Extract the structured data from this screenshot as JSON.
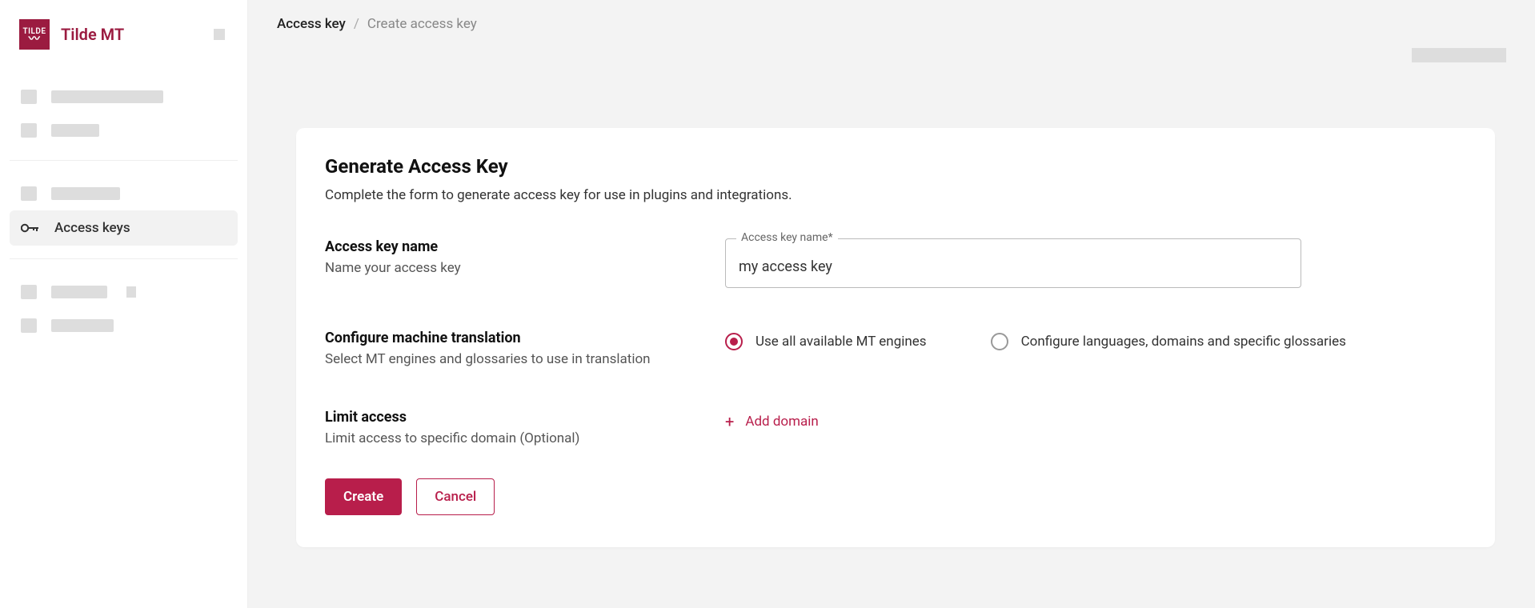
{
  "brand": {
    "logo_text": "TILDE",
    "name": "Tilde MT"
  },
  "sidebar": {
    "active_item_label": "Access keys"
  },
  "breadcrumb": {
    "parent": "Access key",
    "separator": "/",
    "current": "Create access key"
  },
  "page": {
    "title": "Generate Access Key",
    "subtitle": "Complete the form to generate access key for use in plugins and integrations."
  },
  "form": {
    "name_section": {
      "title": "Access key name",
      "desc": "Name your access key",
      "float_label": "Access key name*",
      "value": "my access key"
    },
    "mt_section": {
      "title": "Configure machine translation",
      "desc": "Select MT engines and glossaries to use in translation",
      "option_all": "Use all available MT engines",
      "option_configure": "Configure languages, domains and specific glossaries",
      "selected": "all"
    },
    "limit_section": {
      "title": "Limit access",
      "desc": "Limit access to specific domain (Optional)",
      "add_label": "Add domain"
    }
  },
  "buttons": {
    "create": "Create",
    "cancel": "Cancel"
  }
}
